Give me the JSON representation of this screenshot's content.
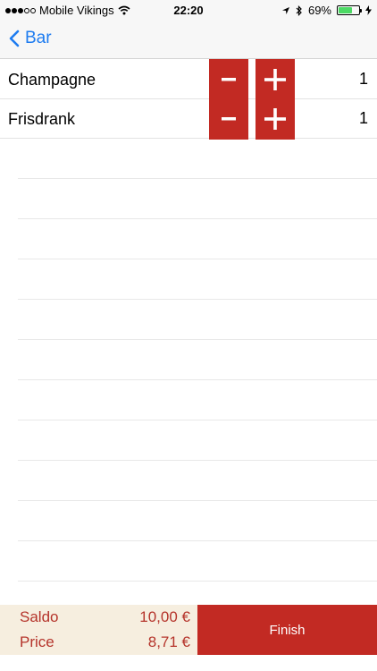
{
  "status_bar": {
    "carrier": "Mobile Vikings",
    "time": "22:20",
    "battery": "69%",
    "battery_level": 0.69
  },
  "nav": {
    "back_label": "Bar"
  },
  "items": [
    {
      "name": "Champagne",
      "minus": "−",
      "plus": "+",
      "count": "1"
    },
    {
      "name": "Frisdrank",
      "minus": "−",
      "plus": "+",
      "count": "1"
    }
  ],
  "footer": {
    "saldo_label": "Saldo",
    "saldo_value": "10,00 €",
    "price_label": "Price",
    "price_value": "8,71 €",
    "finish_label": "Finish"
  },
  "colors": {
    "accent": "#c22a23",
    "link": "#1e7cf0",
    "summary_bg": "#f6eedf"
  }
}
